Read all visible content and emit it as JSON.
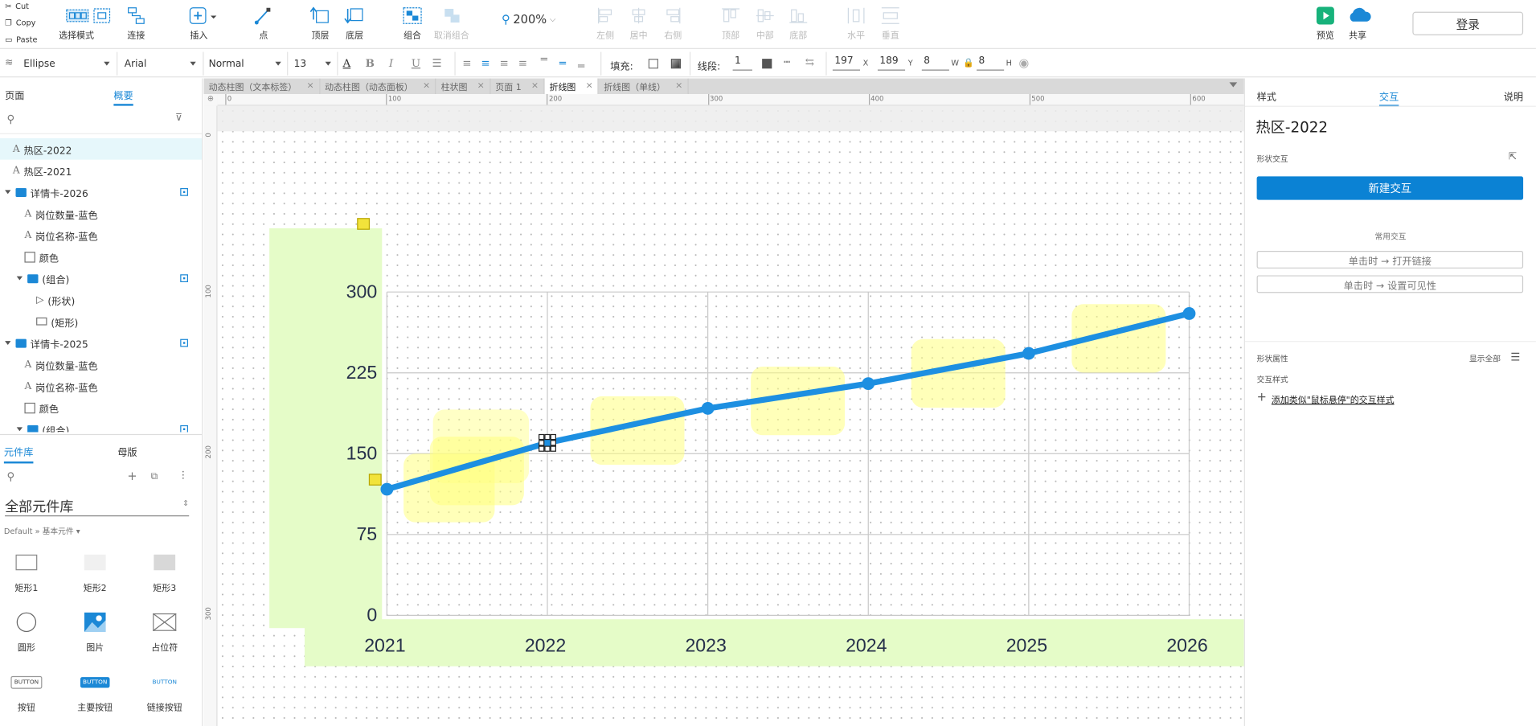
{
  "clipboard": {
    "cut": "Cut",
    "copy": "Copy",
    "paste": "Paste"
  },
  "toolbar": {
    "select_mode": "选择模式",
    "connect": "连接",
    "insert": "插入",
    "point": "点",
    "top_layer": "顶层",
    "bottom_layer": "底层",
    "group": "组合",
    "ungroup": "取消组合",
    "zoom": "200%",
    "align_left": "左侧",
    "align_center": "居中",
    "align_right": "右侧",
    "align_top": "顶部",
    "align_middle": "中部",
    "align_bottom": "底部",
    "dist_h": "水平",
    "dist_v": "垂直",
    "preview": "预览",
    "share": "共享",
    "login": "登录"
  },
  "format": {
    "shape": "Ellipse",
    "font": "Arial",
    "weight": "Normal",
    "size": "13",
    "fill_label": "填充:",
    "line_label": "线段:",
    "line_width": "1",
    "x": "197",
    "y": "189",
    "w": "8",
    "h": "8",
    "x_lab": "X",
    "y_lab": "Y",
    "w_lab": "W",
    "h_lab": "H"
  },
  "left": {
    "tab_pages": "页面",
    "tab_outline": "概要",
    "tree": [
      {
        "label": "热区-2022",
        "icon": "text",
        "indent": 0,
        "selected": true
      },
      {
        "label": "热区-2021",
        "icon": "text",
        "indent": 0
      },
      {
        "label": "详情卡-2026",
        "icon": "folder",
        "indent": 0,
        "expand": true,
        "pin": true
      },
      {
        "label": "岗位数量-蓝色",
        "icon": "text",
        "indent": 1
      },
      {
        "label": "岗位名称-蓝色",
        "icon": "text",
        "indent": 1
      },
      {
        "label": "颜色",
        "icon": "rect",
        "indent": 1
      },
      {
        "label": "(组合)",
        "icon": "folder",
        "indent": 1,
        "expand": true,
        "pin": true
      },
      {
        "label": "(形状)",
        "icon": "tri",
        "indent": 2
      },
      {
        "label": "(矩形)",
        "icon": "rect2",
        "indent": 2
      },
      {
        "label": "详情卡-2025",
        "icon": "folder",
        "indent": 0,
        "expand": true,
        "pin": true
      },
      {
        "label": "岗位数量-蓝色",
        "icon": "text",
        "indent": 1
      },
      {
        "label": "岗位名称-蓝色",
        "icon": "text",
        "indent": 1
      },
      {
        "label": "颜色",
        "icon": "rect",
        "indent": 1
      },
      {
        "label": "(组合)",
        "icon": "folder",
        "indent": 1,
        "expand": true,
        "pin": true
      }
    ],
    "lib_tab": "元件库",
    "master_tab": "母版",
    "lib_select": "全部元件库",
    "lib_path": "Default » 基本元件 ▾",
    "widgets": [
      "矩形1",
      "矩形2",
      "矩形3",
      "圆形",
      "图片",
      "占位符",
      "按钮",
      "主要按钮",
      "链接按钮"
    ],
    "button_caption": "BUTTON"
  },
  "doc_tabs": [
    "动态柱图（文本标签）",
    "动态柱图（动态面板）",
    "柱状图",
    "页面 1",
    "折线图",
    "折线图（单线）"
  ],
  "ruler": {
    "h": [
      "0",
      "100",
      "200",
      "300",
      "400",
      "500",
      "600"
    ],
    "v": [
      "0",
      "100",
      "200",
      "300"
    ]
  },
  "chart_data": {
    "type": "line",
    "x": [
      "2021",
      "2022",
      "2023",
      "2024",
      "2025",
      "2026"
    ],
    "series": [
      {
        "values": [
          117,
          160,
          192,
          215,
          243,
          280
        ]
      }
    ],
    "yticks": [
      "300",
      "225",
      "150",
      "75",
      "0"
    ],
    "ylim": [
      0,
      300
    ],
    "line_color": "#1d8fe1",
    "hotspot_color": "#ffff80",
    "band_color": "#e5fcc8"
  },
  "right": {
    "tab_style": "样式",
    "tab_interact": "交互",
    "tab_notes": "说明",
    "title": "热区-2022",
    "shape_interact": "形状交互",
    "new_interact": "新建交互",
    "common": "常用交互",
    "common1": "单击时 → 打开链接",
    "common2": "单击时 → 设置可见性",
    "props": "形状属性",
    "show_all": "显示全部",
    "interact_style": "交互样式",
    "add_style": "添加类似\"鼠标悬停\"的交互样式"
  }
}
